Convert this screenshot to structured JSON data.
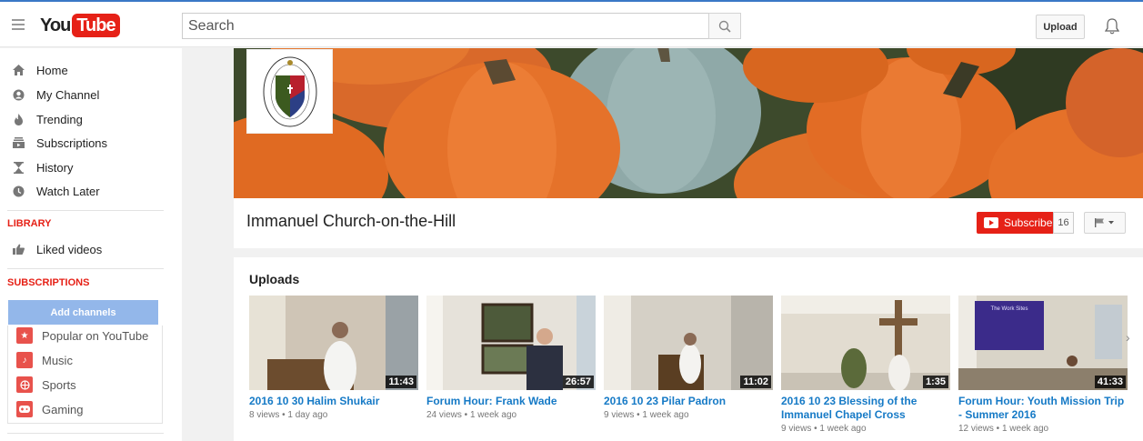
{
  "header": {
    "logo_you": "You",
    "logo_tube": "Tube",
    "search_placeholder": "Search",
    "upload_label": "Upload"
  },
  "sidebar": {
    "items": [
      {
        "label": "Home",
        "icon": "home-icon"
      },
      {
        "label": "My Channel",
        "icon": "person-icon"
      },
      {
        "label": "Trending",
        "icon": "flame-icon"
      },
      {
        "label": "Subscriptions",
        "icon": "subscriptions-icon"
      },
      {
        "label": "History",
        "icon": "hourglass-icon"
      },
      {
        "label": "Watch Later",
        "icon": "clock-icon"
      }
    ],
    "library_title": "LIBRARY",
    "library_items": [
      {
        "label": "Liked videos",
        "icon": "thumbs-up-icon"
      }
    ],
    "subscriptions_title": "SUBSCRIPTIONS",
    "add_channels_label": "Add channels",
    "subscription_items": [
      {
        "label": "Popular on YouTube",
        "icon": "star-icon",
        "color": "#e8524c"
      },
      {
        "label": "Music",
        "icon": "music-note-icon",
        "color": "#e8524c"
      },
      {
        "label": "Sports",
        "icon": "ball-icon",
        "color": "#e8524c"
      },
      {
        "label": "Gaming",
        "icon": "gamepad-icon",
        "color": "#e8524c"
      }
    ]
  },
  "channel": {
    "name": "Immanuel Church-on-the-Hill",
    "subscribe_label": "Subscribe",
    "subscriber_count": "16"
  },
  "uploads": {
    "title": "Uploads",
    "videos": [
      {
        "title": "2016 10 30 Halim Shukair",
        "meta": "8 views • 1 day ago",
        "duration": "11:43"
      },
      {
        "title": "Forum Hour: Frank Wade",
        "meta": "24 views • 1 week ago",
        "duration": "26:57"
      },
      {
        "title": "2016 10 23 Pilar Padron",
        "meta": "9 views • 1 week ago",
        "duration": "11:02"
      },
      {
        "title": "2016 10 23 Blessing of the Immanuel Chapel Cross",
        "meta": "9 views • 1 week ago",
        "duration": "1:35"
      },
      {
        "title": "Forum Hour: Youth Mission Trip - Summer 2016",
        "meta": "12 views • 1 week ago",
        "duration": "41:33"
      }
    ],
    "slide_title": "The Work Sites"
  },
  "colors": {
    "accent_red": "#e62117",
    "link_blue": "#167ac6",
    "add_channels": "#93b7ea"
  }
}
